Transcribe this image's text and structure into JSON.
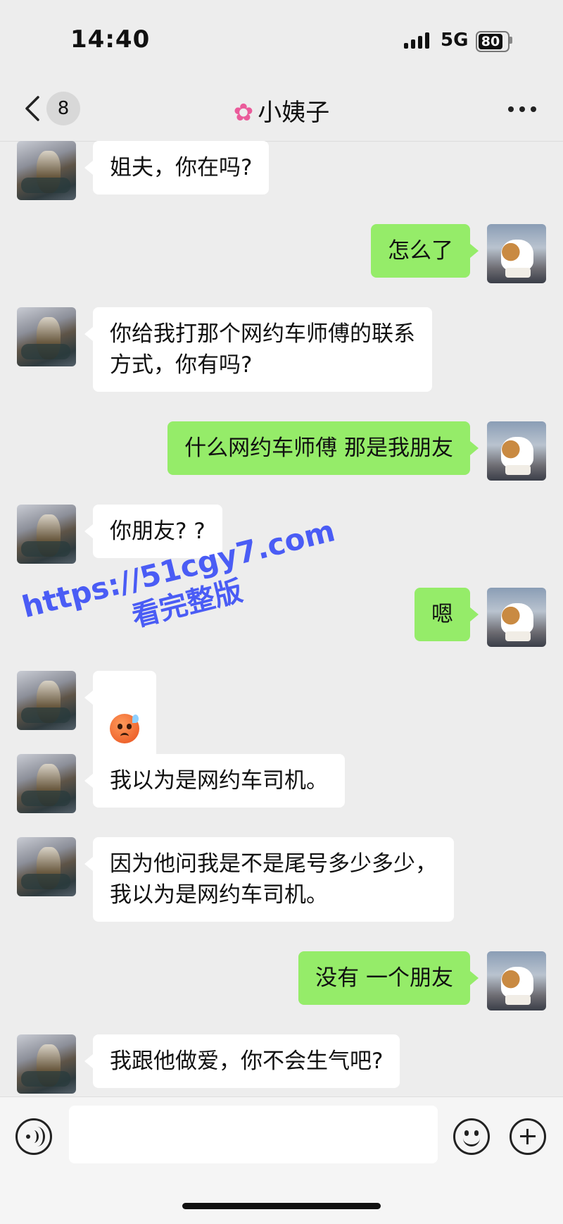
{
  "status_bar": {
    "time": "14:40",
    "network": "5G",
    "battery": "80"
  },
  "header": {
    "unread_count": "8",
    "title": "小姨子",
    "title_icon": "flower-icon"
  },
  "messages": [
    {
      "side": "left",
      "text": "姐夫，你在吗?"
    },
    {
      "side": "right",
      "text": "怎么了"
    },
    {
      "side": "left",
      "text": "你给我打那个网约车师傅的联系\n方式，你有吗?"
    },
    {
      "side": "right",
      "text": "什么网约车师傅 那是我朋友"
    },
    {
      "side": "left",
      "text": "你朋友? ?"
    },
    {
      "side": "right",
      "text": "嗯"
    },
    {
      "side": "left",
      "emoji": "sweat-face-emoji"
    },
    {
      "side": "left",
      "text": "我以为是网约车司机。"
    },
    {
      "side": "left",
      "text": "因为他问我是不是尾号多少多少，\n我以为是网约车司机。"
    },
    {
      "side": "right",
      "text": "没有 一个朋友"
    },
    {
      "side": "left",
      "text": "我跟他做爱，你不会生气吧?"
    }
  ],
  "watermark": {
    "line1": "https://51cgy7.com",
    "line2": "看完整版"
  },
  "input_bar": {
    "input_value": ""
  },
  "colors": {
    "background": "#ededed",
    "bubble_self": "#95ec69",
    "bubble_other": "#ffffff",
    "watermark": "#4a5cf5"
  }
}
